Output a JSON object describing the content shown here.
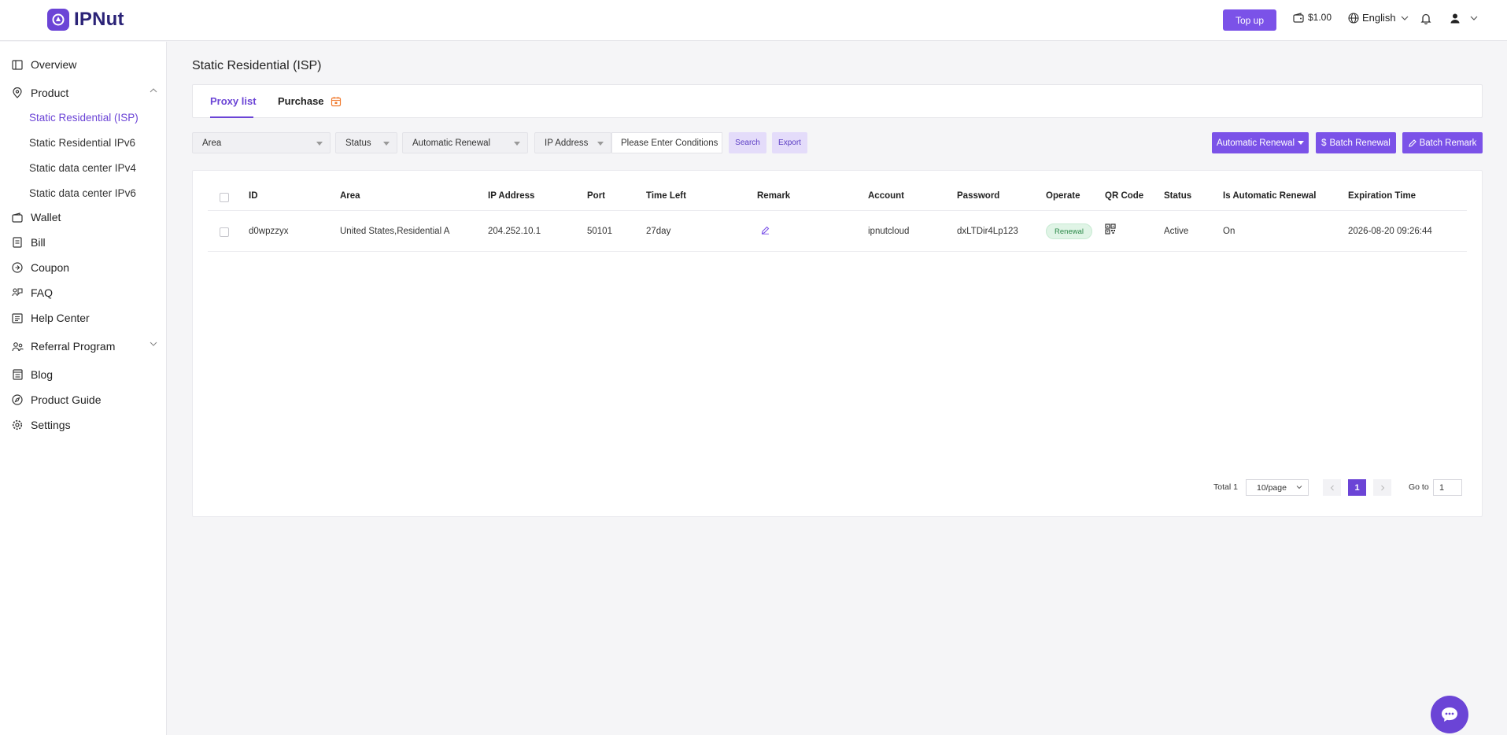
{
  "header": {
    "brand": "IPNut",
    "topup_label": "Top up",
    "balance": "$1.00",
    "language": "English"
  },
  "sidebar": {
    "items": [
      {
        "label": "Overview",
        "icon": "layout-icon"
      },
      {
        "label": "Product",
        "icon": "product-icon",
        "expanded": true
      },
      {
        "label": "Wallet",
        "icon": "wallet-icon"
      },
      {
        "label": "Bill",
        "icon": "bill-icon"
      },
      {
        "label": "Coupon",
        "icon": "coupon-icon"
      },
      {
        "label": "FAQ",
        "icon": "faq-icon"
      },
      {
        "label": "Help Center",
        "icon": "help-icon"
      },
      {
        "label": "Referral Program",
        "icon": "referral-icon",
        "expanded": false
      },
      {
        "label": "Blog",
        "icon": "blog-icon"
      },
      {
        "label": "Product Guide",
        "icon": "compass-icon"
      },
      {
        "label": "Settings",
        "icon": "gear-icon"
      }
    ],
    "product_sub": [
      {
        "label": "Static Residential (ISP)",
        "active": true
      },
      {
        "label": "Static Residential IPv6"
      },
      {
        "label": "Static data center IPv4"
      },
      {
        "label": "Static data center IPv6"
      }
    ]
  },
  "main": {
    "title": "Static Residential (ISP)",
    "tabs": [
      {
        "label": "Proxy list",
        "active": true
      },
      {
        "label": "Purchase"
      }
    ],
    "filters": {
      "area": "Area",
      "status": "Status",
      "auto_renewal": "Automatic Renewal",
      "ip_type": "IP Address",
      "condition_placeholder": "Please Enter Conditions",
      "search_label": "Search",
      "export_label": "Export"
    },
    "actions": {
      "auto_renewal_label": "Automatic Renewal",
      "batch_renewal_label": "Batch Renewal",
      "batch_remark_label": "Batch Remark"
    },
    "table": {
      "columns": [
        "ID",
        "Area",
        "IP Address",
        "Port",
        "Time Left",
        "Remark",
        "Account",
        "Password",
        "Operate",
        "QR Code",
        "Status",
        "Is Automatic Renewal",
        "Expiration Time"
      ],
      "rows": [
        {
          "id": "d0wpzzyx",
          "area": "United States,Residential A",
          "ip": "204.252.10.1",
          "port": "50101",
          "time_left": "27day",
          "account": "ipnutcloud",
          "password": "dxLTDir4Lp123",
          "operate": "Renewal",
          "status": "Active",
          "auto_renewal": "On",
          "expiration": "2026-08-20 09:26:44"
        }
      ]
    },
    "pagination": {
      "total": "Total 1",
      "page_size": "10/page",
      "current_page": "1",
      "goto_label": "Go to",
      "goto_value": "1"
    }
  },
  "colors": {
    "accent": "#6b44d6",
    "button": "#7b52e8",
    "light_button": "#e4dcfa",
    "success_bg": "#e0f4e6"
  }
}
